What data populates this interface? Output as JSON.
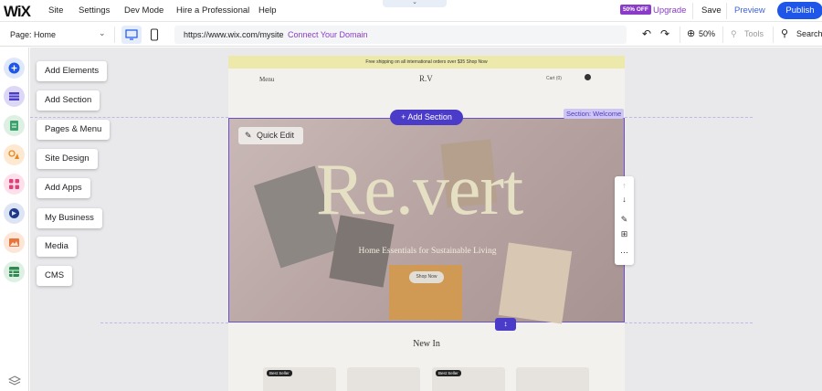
{
  "topbar": {
    "logo": "WiX",
    "menu": [
      "Site",
      "Settings",
      "Dev Mode",
      "Hire a Professional",
      "Help"
    ],
    "upgrade_badge": "50% OFF",
    "upgrade": "Upgrade",
    "save": "Save",
    "preview": "Preview",
    "publish": "Publish"
  },
  "toolbar": {
    "page_select": "Page: Home",
    "url": "https://www.wix.com/mysite",
    "connect_domain": "Connect Your Domain",
    "zoom": "50%",
    "tools": "Tools",
    "search": "Search"
  },
  "left_panel": {
    "items": [
      {
        "label": "Add Elements",
        "icon": "plus-icon",
        "color": "#1d56e8"
      },
      {
        "label": "Add Section",
        "icon": "section-icon",
        "color": "#4a3bc9"
      },
      {
        "label": "Pages & Menu",
        "icon": "pages-icon",
        "color": "#3aa26a"
      },
      {
        "label": "Site Design",
        "icon": "palette-icon",
        "color": "#e58a1f"
      },
      {
        "label": "Add Apps",
        "icon": "apps-icon",
        "color": "#e0407a"
      },
      {
        "label": "My Business",
        "icon": "business-icon",
        "color": "#1f3a8a"
      },
      {
        "label": "Media",
        "icon": "media-icon",
        "color": "#e8743b"
      },
      {
        "label": "CMS",
        "icon": "cms-icon",
        "color": "#2f8a4f"
      }
    ]
  },
  "site": {
    "promo": "Free shipping on all international orders over $35 Shop Now",
    "nav_menu": "Menu",
    "brand": "R.V",
    "cart": "Cart (0)",
    "hero_title": "Re.vert",
    "hero_subtitle": "Home Essentials for Sustainable Living",
    "shop_now": "Shop Now",
    "new_in": "New In",
    "card_badge": "Best Seller"
  },
  "editor": {
    "add_section": "Add Section",
    "section_label": "Section: Welcome",
    "quick_edit": "Quick Edit"
  }
}
